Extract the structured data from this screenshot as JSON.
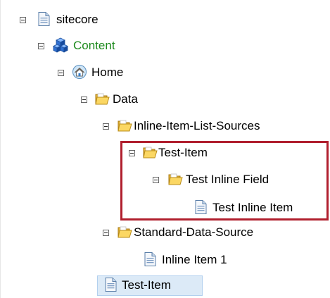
{
  "tree": {
    "items": [
      {
        "label": "sitecore",
        "icon": "page-icon"
      },
      {
        "label": "Content",
        "icon": "cubes-icon"
      },
      {
        "label": "Home",
        "icon": "home-icon"
      },
      {
        "label": "Data",
        "icon": "folder-icon"
      },
      {
        "label": "Inline-Item-List-Sources",
        "icon": "folder-icon"
      },
      {
        "label": "Test-Item",
        "icon": "folder-icon"
      },
      {
        "label": "Test Inline Field",
        "icon": "folder-icon"
      },
      {
        "label": "Test Inline Item",
        "icon": "page-icon"
      },
      {
        "label": "Standard-Data-Source",
        "icon": "folder-icon"
      },
      {
        "label": "Inline Item 1",
        "icon": "page-icon"
      },
      {
        "label": "Test-Item",
        "icon": "page-icon"
      }
    ]
  },
  "colors": {
    "content_label": "#1d8a1d",
    "highlight_border": "#b01f2e",
    "selected_bg": "#dceaf7"
  }
}
